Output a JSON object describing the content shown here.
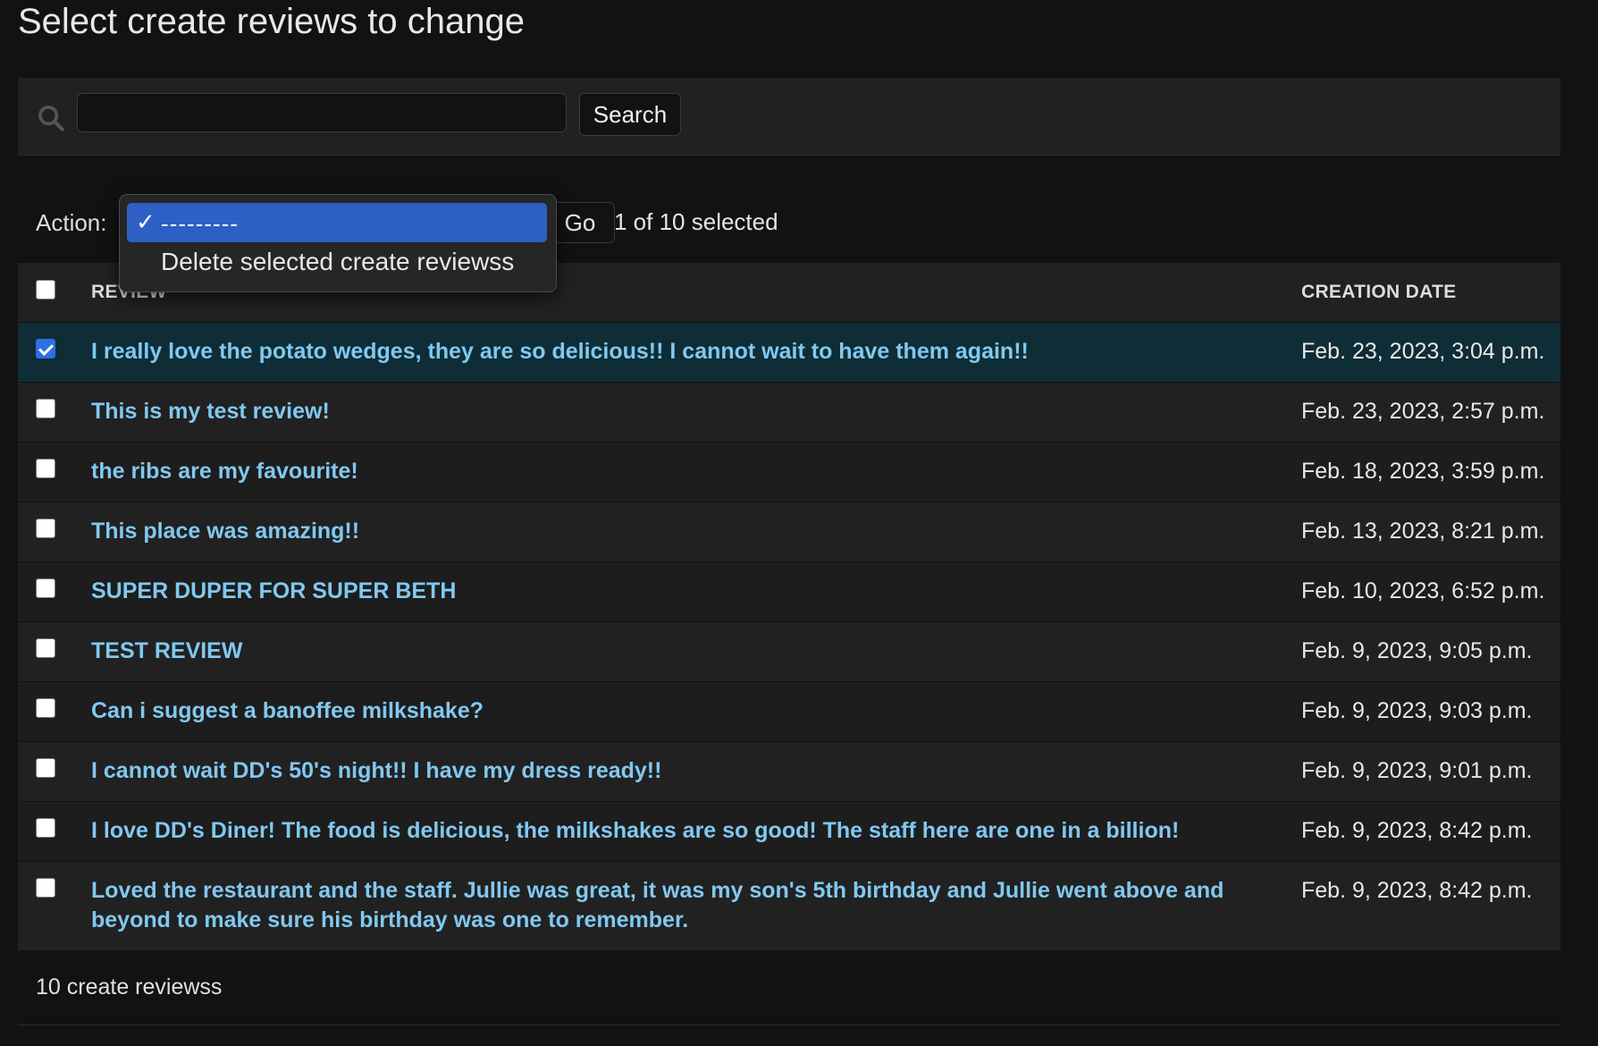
{
  "page": {
    "title": "Select create reviews to change"
  },
  "search": {
    "icon": "search-icon",
    "value": "",
    "button_label": "Search"
  },
  "actions": {
    "label": "Action:",
    "go_label": "Go",
    "selected_count": "1 of 10 selected",
    "dropdown": {
      "selected_option": "---------",
      "options": [
        "---------",
        "Delete selected create reviewss"
      ]
    }
  },
  "table": {
    "headers": {
      "review": "REVIEW",
      "creation_date": "CREATION DATE"
    },
    "rows": [
      {
        "review": "I really love the potato wedges, they are so delicious!! I cannot wait to have them again!!",
        "date": "Feb. 23, 2023, 3:04 p.m.",
        "checked": true
      },
      {
        "review": "This is my test review!",
        "date": "Feb. 23, 2023, 2:57 p.m.",
        "checked": false
      },
      {
        "review": "the ribs are my favourite!",
        "date": "Feb. 18, 2023, 3:59 p.m.",
        "checked": false
      },
      {
        "review": "This place was amazing!!",
        "date": "Feb. 13, 2023, 8:21 p.m.",
        "checked": false
      },
      {
        "review": "SUPER DUPER FOR SUPER BETH",
        "date": "Feb. 10, 2023, 6:52 p.m.",
        "checked": false
      },
      {
        "review": "TEST REVIEW",
        "date": "Feb. 9, 2023, 9:05 p.m.",
        "checked": false
      },
      {
        "review": "Can i suggest a banoffee milkshake?",
        "date": "Feb. 9, 2023, 9:03 p.m.",
        "checked": false
      },
      {
        "review": "I cannot wait DD's 50's night!! I have my dress ready!!",
        "date": "Feb. 9, 2023, 9:01 p.m.",
        "checked": false
      },
      {
        "review": "I love DD's Diner! The food is delicious, the milkshakes are so good! The staff here are one in a billion!",
        "date": "Feb. 9, 2023, 8:42 p.m.",
        "checked": false
      },
      {
        "review": "Loved the restaurant and the staff. Jullie was great, it was my son's 5th birthday and Jullie went above and beyond to make sure his birthday was one to remember.",
        "date": "Feb. 9, 2023, 8:42 p.m.",
        "checked": false
      }
    ]
  },
  "paginator": {
    "text": "10 create reviewss"
  },
  "colors": {
    "background": "#121212",
    "link": "#81c8f0",
    "selected_row": "#0f2d36",
    "accent": "#2e5fc4"
  }
}
